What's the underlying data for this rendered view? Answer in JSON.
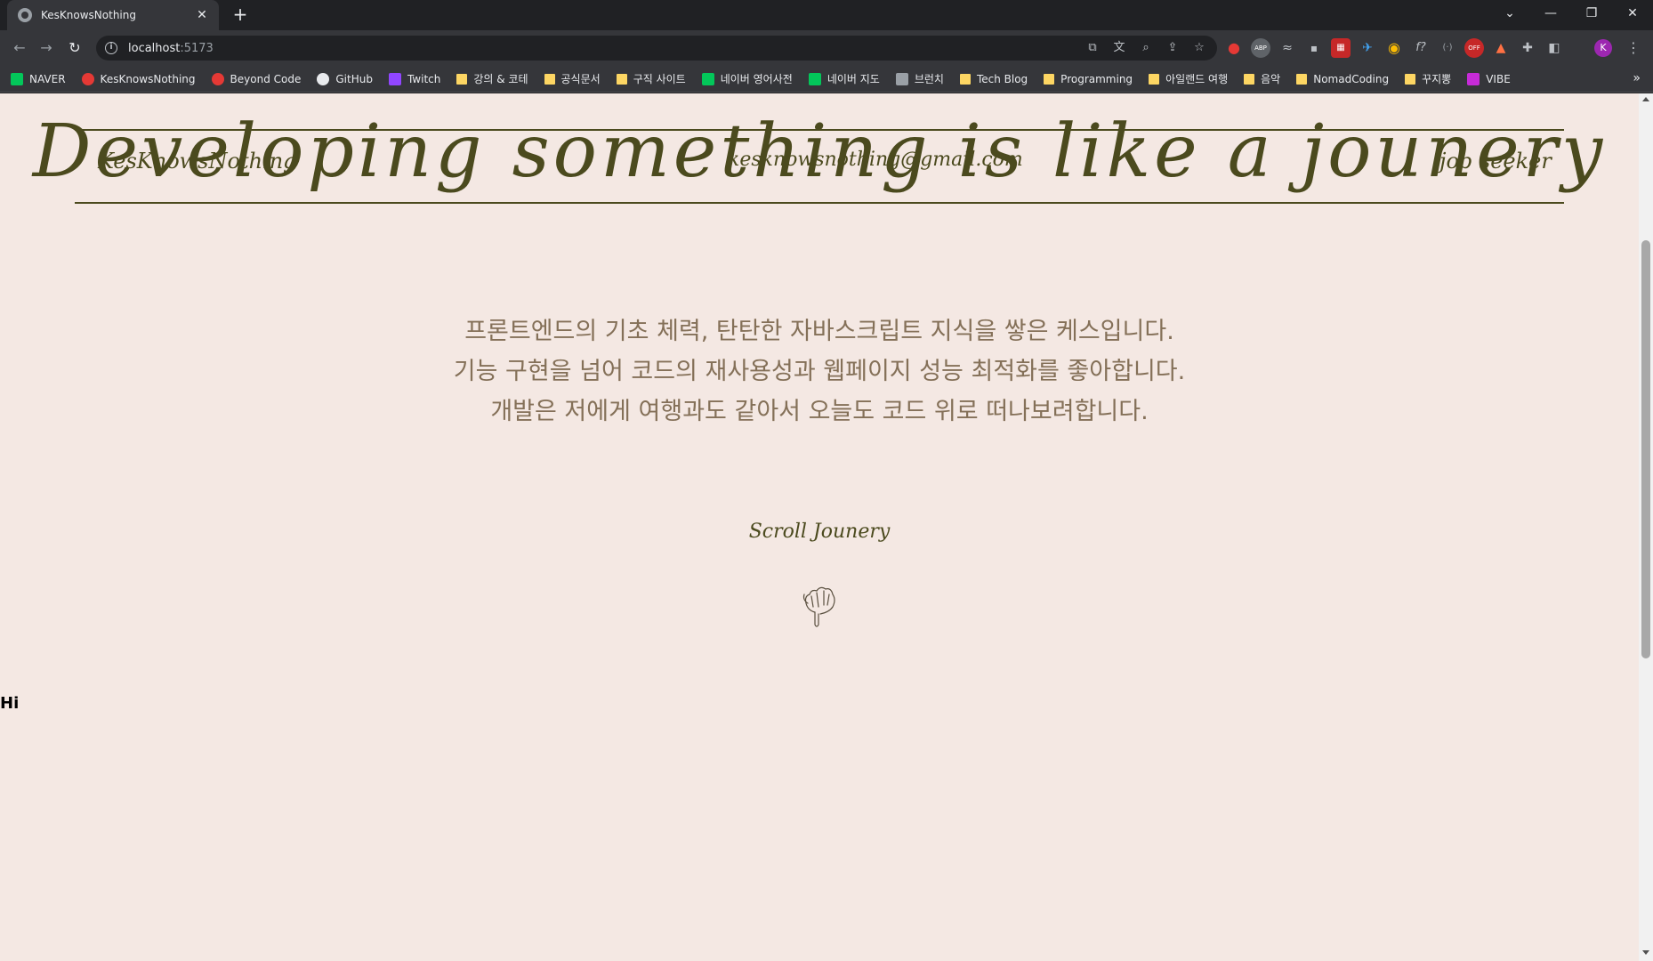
{
  "browser": {
    "tab_title": "KesKnowsNothing",
    "tab_close": "✕",
    "new_tab": "+",
    "window_controls": [
      "⌄",
      "—",
      "❐",
      "✕"
    ],
    "url_host": "localhost",
    "url_port": ":5173",
    "bookmarks": [
      {
        "label": "NAVER",
        "icon": "naver-icon",
        "color": "#03c75a"
      },
      {
        "label": "KesKnowsNothing",
        "icon": "kes-icon",
        "color": "#e53935"
      },
      {
        "label": "Beyond Code",
        "icon": "beyond-icon",
        "color": "#e53935"
      },
      {
        "label": "GitHub",
        "icon": "github-icon",
        "color": "#e8eaed"
      },
      {
        "label": "Twitch",
        "icon": "twitch-icon",
        "color": "#9146ff"
      },
      {
        "label": "강의 & 코테",
        "icon": "folder-icon"
      },
      {
        "label": "공식문서",
        "icon": "folder-icon"
      },
      {
        "label": "구직 사이트",
        "icon": "folder-icon"
      },
      {
        "label": "네이버 영어사전",
        "icon": "dictionary-icon",
        "color": "#03c75a"
      },
      {
        "label": "네이버 지도",
        "icon": "map-icon",
        "color": "#03c75a"
      },
      {
        "label": "브런치",
        "icon": "brunch-icon",
        "color": "#9aa0a6"
      },
      {
        "label": "Tech Blog",
        "icon": "folder-icon"
      },
      {
        "label": "Programming",
        "icon": "folder-icon"
      },
      {
        "label": "아일랜드 여행",
        "icon": "folder-icon"
      },
      {
        "label": "음악",
        "icon": "folder-icon"
      },
      {
        "label": "NomadCoding",
        "icon": "folder-icon"
      },
      {
        "label": "꾸지뽕",
        "icon": "folder-icon"
      },
      {
        "label": "VIBE",
        "icon": "vibe-icon",
        "color": "#c62bd8"
      }
    ],
    "bookmarks_more": "»",
    "avatar_letter": "K"
  },
  "page": {
    "header_left": "KesKnowsNothing",
    "header_email": "kesknowsnothing@gmail.com",
    "header_right": "job seeker",
    "hero_title": "Developing something is like a jounery",
    "intro_lines": [
      "프론트엔드의 기초 체력, 탄탄한 자바스크립트 지식을 쌓은 케스입니다.",
      "기능 구현을 넘어 코드의 재사용성과 웹페이지 성능 최적화를 좋아합니다.",
      "개발은 저에게 여행과도 같아서 오늘도 코드 위로 떠나보려합니다."
    ],
    "scroll_label": "Scroll Jounery",
    "hi_text": "Hi"
  },
  "colors": {
    "page_bg": "#f4e8e3",
    "accent_olive": "#4b4a1e",
    "intro_text": "#847058"
  }
}
